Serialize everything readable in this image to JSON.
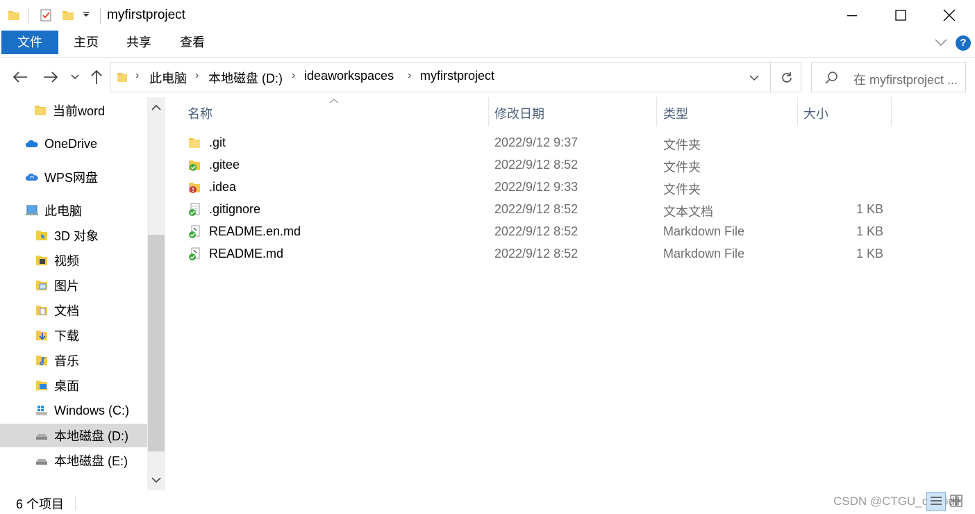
{
  "window": {
    "title": "myfirstproject"
  },
  "ribbon": {
    "tabs": [
      {
        "label": "文件",
        "active": true
      },
      {
        "label": "主页",
        "active": false
      },
      {
        "label": "共享",
        "active": false
      },
      {
        "label": "查看",
        "active": false
      }
    ],
    "help_label": "?"
  },
  "address": {
    "crumbs": [
      "此电脑",
      "本地磁盘 (D:)",
      "ideaworkspaces",
      "myfirstproject"
    ],
    "search_placeholder": "在 myfirstproject ..."
  },
  "sidebar": {
    "items": [
      {
        "label": "当前word",
        "icon": "folder-icon"
      },
      {
        "label": "OneDrive",
        "icon": "onedrive-cloud-icon"
      },
      {
        "label": "WPS网盘",
        "icon": "wps-cloud-icon"
      },
      {
        "label": "此电脑",
        "icon": "computer-icon"
      },
      {
        "label": "3D 对象",
        "icon": "3d-objects-folder-icon"
      },
      {
        "label": "视频",
        "icon": "videos-folder-icon"
      },
      {
        "label": "图片",
        "icon": "pictures-folder-icon"
      },
      {
        "label": "文档",
        "icon": "documents-folder-icon"
      },
      {
        "label": "下载",
        "icon": "downloads-folder-icon"
      },
      {
        "label": "音乐",
        "icon": "music-folder-icon"
      },
      {
        "label": "桌面",
        "icon": "desktop-folder-icon"
      },
      {
        "label": "Windows (C:)",
        "icon": "windows-drive-icon"
      },
      {
        "label": "本地磁盘 (D:)",
        "icon": "drive-icon",
        "selected": true
      },
      {
        "label": "本地磁盘 (E:)",
        "icon": "drive-icon"
      }
    ]
  },
  "filelist": {
    "columns": [
      "名称",
      "修改日期",
      "类型",
      "大小"
    ],
    "rows": [
      {
        "name": ".git",
        "date": "2022/9/12 9:37",
        "type": "文件夹",
        "size": "",
        "icon": "folder-icon"
      },
      {
        "name": ".gitee",
        "date": "2022/9/12 8:52",
        "type": "文件夹",
        "size": "",
        "icon": "folder-synced-icon"
      },
      {
        "name": ".idea",
        "date": "2022/9/12 9:33",
        "type": "文件夹",
        "size": "",
        "icon": "folder-modified-icon"
      },
      {
        "name": ".gitignore",
        "date": "2022/9/12 8:52",
        "type": "文本文档",
        "size": "1 KB",
        "icon": "text-file-synced-icon"
      },
      {
        "name": "README.en.md",
        "date": "2022/9/12 8:52",
        "type": "Markdown File",
        "size": "1 KB",
        "icon": "markdown-file-synced-icon"
      },
      {
        "name": "README.md",
        "date": "2022/9/12 8:52",
        "type": "Markdown File",
        "size": "1 KB",
        "icon": "markdown-file-synced-icon"
      }
    ]
  },
  "status": {
    "count": "6 个项目",
    "watermark": "CSDN @CTGU_daffodil"
  },
  "colors": {
    "accent": "#1a6fc7",
    "folder": "#f2c94c",
    "sync_ok": "#3cab3c",
    "sync_modified": "#d13a2a"
  }
}
